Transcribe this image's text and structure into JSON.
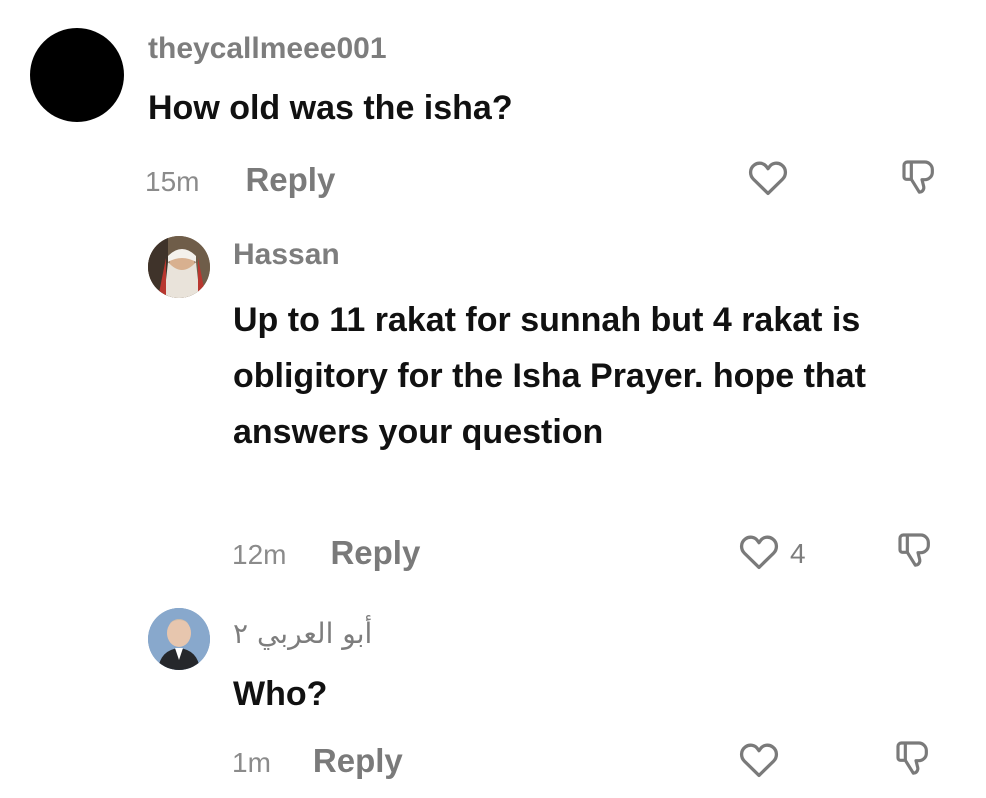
{
  "comments": [
    {
      "username": "theycallmeee001",
      "text": "How old was the isha?",
      "time": "15m",
      "reply_label": "Reply",
      "likes": ""
    },
    {
      "username": "Hassan",
      "text": "Up to 11 rakat for sunnah but 4 rakat is obligitory for the Isha Prayer. hope that answers your question",
      "time": "12m",
      "reply_label": "Reply",
      "likes": "4"
    },
    {
      "username": "أبو العربي ٢",
      "text": "Who?",
      "time": "1m",
      "reply_label": "Reply",
      "likes": ""
    }
  ],
  "icons": {
    "like": "heart-outline-icon",
    "dislike": "thumbs-down-outline-icon"
  },
  "colors": {
    "username": "#7d7d7d",
    "text": "#111111",
    "meta": "#8b8b8b",
    "icon_stroke": "#7a7a7a"
  }
}
